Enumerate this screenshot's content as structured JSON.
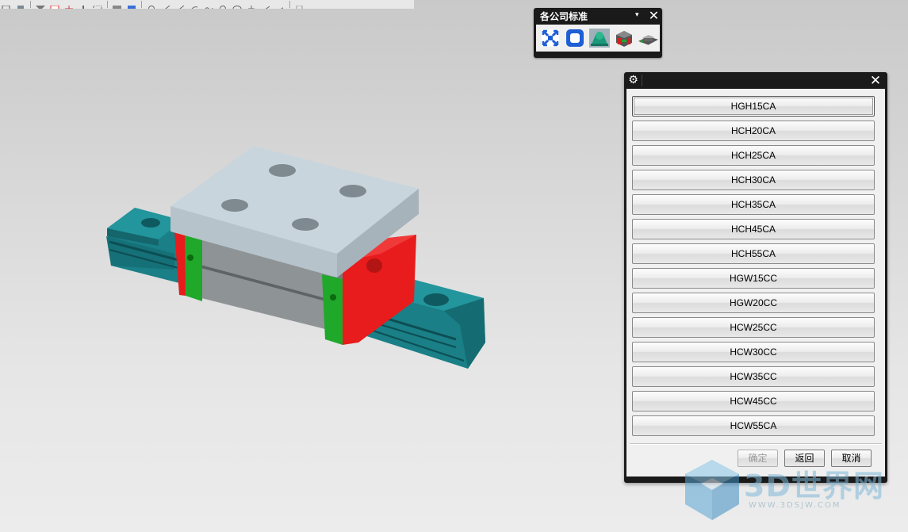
{
  "palette": {
    "title": "各公司标准",
    "dropdown_glyph": "▾",
    "close_glyph": "✕",
    "buttons": [
      "fit-frame-icon",
      "rounded-square-icon",
      "support-bracket-icon",
      "guide-block-icon",
      "rail-carriage-icon"
    ]
  },
  "dialog": {
    "gear_glyph": "⚙",
    "close_glyph": "✕",
    "options": [
      "HGH15CA",
      "HCH20CA",
      "HCH25CA",
      "HCH30CA",
      "HCH35CA",
      "HCH45CA",
      "HCH55CA",
      "HGW15CC",
      "HGW20CC",
      "HCW25CC",
      "HCW30CC",
      "HCW35CC",
      "HCW45CC",
      "HCW55CA"
    ],
    "ok_label": "确定",
    "back_label": "返回",
    "cancel_label": "取消"
  },
  "watermark": {
    "text": "3D世界网",
    "url": "WWW.3DSJW.COM"
  },
  "colors": {
    "rail": "#167a80",
    "block_gray": "#8a8f92",
    "top_plate": "#c9d5dc",
    "end_cap": "#e81c1c",
    "seal": "#1fa82a"
  }
}
